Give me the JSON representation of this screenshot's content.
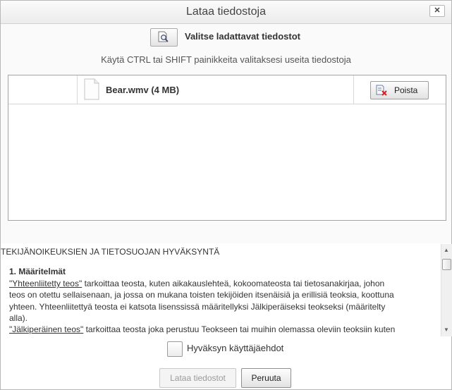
{
  "dialog": {
    "title": "Lataa tiedostoja",
    "close_label": "✕"
  },
  "select": {
    "button_icon": "file-search-icon",
    "label": "Valitse ladattavat tiedostot",
    "hint": "Käytä CTRL tai SHIFT painikkeita valitaksesi useita tiedostoja"
  },
  "files": [
    {
      "name": "Bear.wmv (4 MB)",
      "icon": "file-icon",
      "remove_label": "Poista",
      "remove_icon": "remove-file-icon"
    }
  ],
  "terms": {
    "heading": "TEKIJÄNOIKEUKSIEN JA TIETOSUOJAN HYVÄKSYNTÄ",
    "section_title": "1. Määritelmät",
    "def1_term": "\"Yhteenliitetty teos\"",
    "def1_rest": " tarkoittaa teosta, kuten aikakauslehteä, kokoomateosta tai tietosanakirjaa, johon",
    "line2": "teos on otettu sellaisenaan, ja jossa on mukana toisten tekijöiden itsenäisiä ja erillisiä teoksia, koottuna",
    "line3": "yhteen. Yhteenliitettyä teosta ei katsota lisenssissä määritellyksi Jälkiperäiseksi teokseksi (määritelty",
    "line4": "alla).",
    "def2_term": "\"Jälkiperäinen teos\"",
    "def2_rest": " tarkoittaa teosta joka perustuu Teokseen tai muihin olemassa oleviin teoksiin kuten"
  },
  "accept": {
    "label": "Hyväksyn käyttäjäehdot",
    "checked": false
  },
  "actions": {
    "upload_label": "Lataa tiedostot",
    "cancel_label": "Peruuta"
  },
  "scroll": {
    "up_arrow": "▲",
    "down_arrow": "▼"
  }
}
